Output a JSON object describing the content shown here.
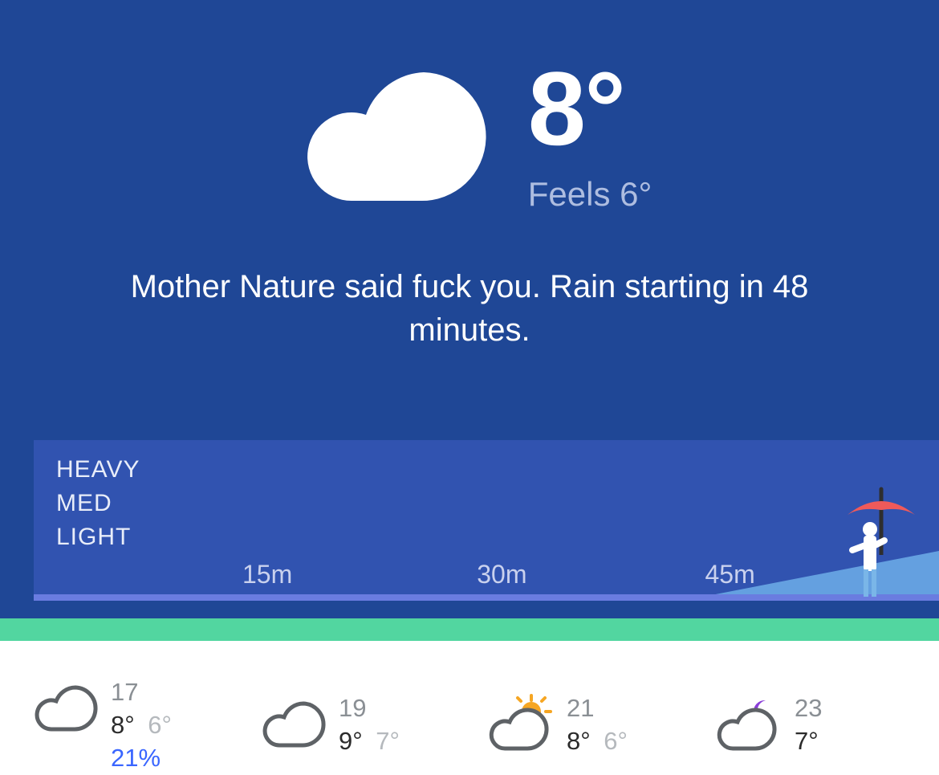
{
  "current": {
    "temp": "8°",
    "feels": "Feels 6°",
    "message": "Mother Nature said fuck you. Rain starting in 48 minutes."
  },
  "precip": {
    "labels": {
      "heavy": "HEAVY",
      "med": "MED",
      "light": "LIGHT"
    },
    "times": {
      "t15": "15m",
      "t30": "30m",
      "t45": "45m"
    }
  },
  "hourly": {
    "h0": {
      "time": "17",
      "temp": "8°",
      "feels": "6°",
      "precip": "21%"
    },
    "h1": {
      "time": "19",
      "temp": "9°",
      "feels": "7°"
    },
    "h2": {
      "time": "21",
      "temp": "8°",
      "feels": "6°"
    },
    "h3": {
      "time": "23",
      "temp": "7°"
    }
  }
}
